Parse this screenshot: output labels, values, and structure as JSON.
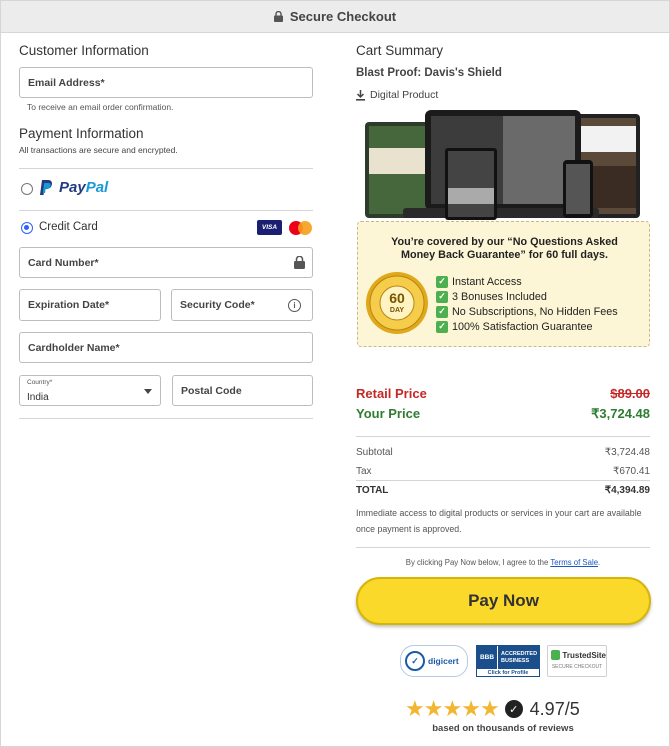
{
  "header": {
    "title": "Secure Checkout"
  },
  "customer": {
    "heading": "Customer Information",
    "email_placeholder": "Email Address*",
    "email_hint": "To receive an email order confirmation."
  },
  "payment": {
    "heading": "Payment Information",
    "subheading": "All transactions are secure and encrypted.",
    "paypal": {
      "word1": "Pay",
      "word2": "Pal"
    },
    "credit_card_label": "Credit Card",
    "visa_label": "VISA",
    "card_number_placeholder": "Card Number*",
    "expiration_placeholder": "Expiration Date*",
    "security_code_placeholder": "Security Code*",
    "cardholder_placeholder": "Cardholder Name*",
    "country_label": "Country*",
    "country_value": "India",
    "postal_placeholder": "Postal Code",
    "selected_method": "credit_card"
  },
  "cart": {
    "heading": "Cart Summary",
    "product_title": "Blast Proof: Davis's Shield",
    "product_type": "Digital Product",
    "guarantee": {
      "line1": "You’re covered by our “No Questions Asked",
      "line2": "Money Back Guarantee” for 60 full days.",
      "items": [
        "Instant Access",
        "3 Bonuses Included",
        "No Subscriptions, No Hidden Fees",
        "100% Satisfaction Guarantee"
      ]
    },
    "retail_label": "Retail Price",
    "retail_value": "$89.00",
    "your_label": "Your Price",
    "your_value": "₹3,724.48",
    "subtotal_label": "Subtotal",
    "subtotal_value": "₹3,724.48",
    "tax_label": "Tax",
    "tax_value": "₹670.41",
    "total_label": "TOTAL",
    "total_value": "₹4,394.89",
    "note": "Immediate access to digital products or services in your cart are available once payment is approved.",
    "terms_prefix": "By clicking Pay Now below, I agree to the ",
    "terms_link": "Terms of Sale",
    "terms_suffix": ".",
    "pay_button": "Pay Now"
  },
  "trust": {
    "digicert": "digicert",
    "bbb_line1": "ACCREDITED",
    "bbb_line2": "BUSINESS",
    "bbb_sub": "Click for Profile",
    "trustedsite": "TrustedSite",
    "trustedsite_sub": "SECURE CHECKOUT"
  },
  "rating": {
    "score": "4.97/5",
    "subtitle": "based on thousands of reviews",
    "stars": 5
  },
  "colors": {
    "accent": "#2962ff",
    "pay_button": "#fbd92a",
    "retail": "#c62828",
    "your_price": "#2e7d32"
  }
}
